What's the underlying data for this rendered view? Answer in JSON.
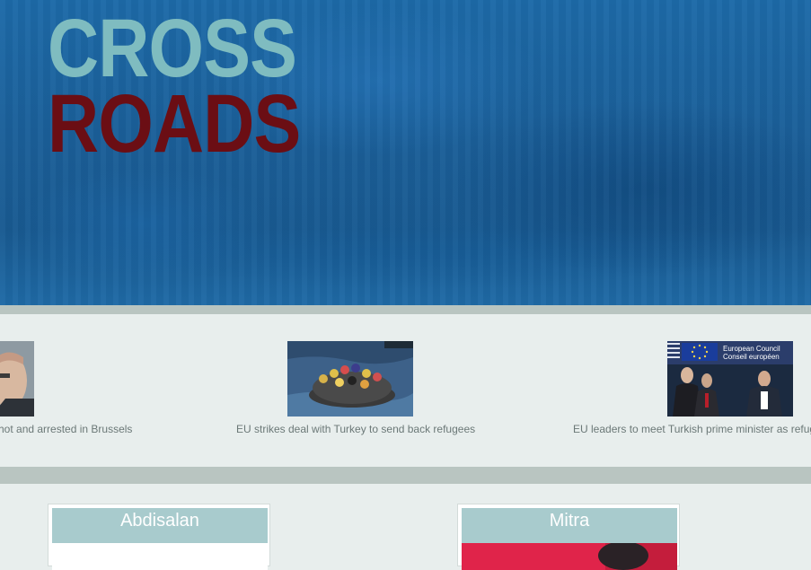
{
  "site": {
    "logo_line_1": "CROSS",
    "logo_line_2": "ROADS"
  },
  "news": [
    {
      "caption": "hot and arrested in Brussels",
      "image": "portrait-photo"
    },
    {
      "caption": "EU strikes deal with Turkey to send back refugees",
      "image": "refugee-boat-photo"
    },
    {
      "caption": "EU leaders to meet Turkish prime minister as refuge",
      "image": "european-council-photo"
    }
  ],
  "profiles": [
    {
      "name": "Abdisalan"
    },
    {
      "name": "Mitra"
    }
  ],
  "colors": {
    "hero_blue": "#1b5f99",
    "logo_cross": "#7fbcc0",
    "logo_roads": "#6b0e14",
    "page_bg": "#e8eeed",
    "divider": "#b9c5c1",
    "profile_header": "#a8cbcd"
  }
}
